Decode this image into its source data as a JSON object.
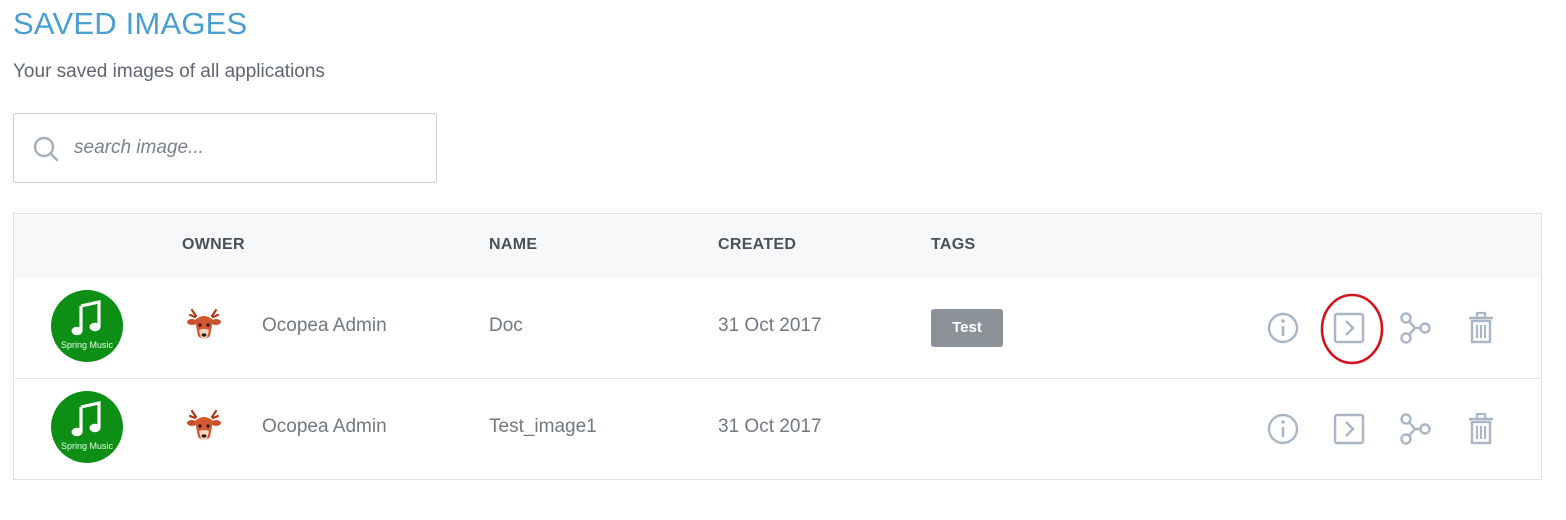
{
  "page": {
    "title": "SAVED IMAGES",
    "subtitle": "Your saved images of all applications"
  },
  "search": {
    "placeholder": "search image...",
    "value": "",
    "icon": "search-icon"
  },
  "table": {
    "columns": [
      "",
      "OWNER",
      "NAME",
      "CREATED",
      "TAGS"
    ],
    "rows": [
      {
        "app_logo_text": "Spring Music",
        "owner_avatar": "deer-avatar-icon",
        "owner": "Ocopea Admin",
        "name": "Doc",
        "created": "31 Oct 2017",
        "tags": [
          "Test"
        ],
        "actions": [
          "info-icon",
          "deploy-icon",
          "share-icon",
          "delete-icon"
        ]
      },
      {
        "app_logo_text": "Spring Music",
        "owner_avatar": "deer-avatar-icon",
        "owner": "Ocopea Admin",
        "name": "Test_image1",
        "created": "31 Oct 2017",
        "tags": [],
        "actions": [
          "info-icon",
          "deploy-icon",
          "share-icon",
          "delete-icon"
        ]
      }
    ]
  },
  "colors": {
    "title": "#4a9fd0",
    "app_logo_bg": "#0d8f16",
    "tag_bg": "#8a9199",
    "action_icon": "#a9b6c6",
    "highlight": "#d0141e"
  }
}
